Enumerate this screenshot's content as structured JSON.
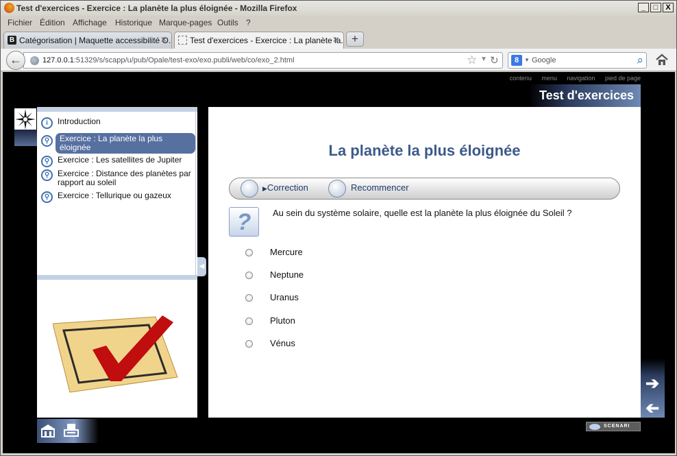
{
  "window": {
    "title": "Test d'exercices - Exercice : La planète la plus éloignée - Mozilla Firefox",
    "controls": {
      "minimize": "_",
      "maximize": "□",
      "close": "X"
    }
  },
  "menu": {
    "items": [
      "Fichier",
      "Édition",
      "Affichage",
      "Historique",
      "Marque-pages",
      "Outils",
      "?"
    ]
  },
  "tabs": [
    {
      "label": "Catégorisation | Maquette accessibilité O...",
      "favicon": "B",
      "active": false
    },
    {
      "label": "Test d'exercices - Exercice : La planète la...",
      "active": true
    }
  ],
  "new_tab_label": "+",
  "navbar": {
    "url_host": "127.0.0.1",
    "url_rest": ":51329/s/scapp/u/pub/Opale/test-exo/exo.publi/web/co/exo_2.html",
    "search_engine_icon": "8",
    "search_placeholder": "Google"
  },
  "access_links": [
    "contenu",
    "menu",
    "navigation",
    "pied de page"
  ],
  "module_title": "Test d'exercices",
  "outline": {
    "items": [
      {
        "label": "Introduction",
        "icon": "i"
      },
      {
        "label": "Exercice : La planète la plus éloignée",
        "icon": "exercise-icon",
        "selected": true
      },
      {
        "label": "Exercice : Les satellites de Jupiter",
        "icon": "exercise-icon"
      },
      {
        "label": "Exercice : Distance des planètes par rapport au soleil",
        "icon": "exercise-icon"
      },
      {
        "label": "Exercice : Tellurique ou gazeux",
        "icon": "exercise-icon"
      }
    ]
  },
  "exercise": {
    "title": "La planète la plus éloignée",
    "toolbar": {
      "correction": "Correction",
      "restart": "Recommencer"
    },
    "question_icon": "?",
    "question": "Au sein du système solaire, quelle est la planète la plus éloignée du Soleil ?",
    "choices": [
      "Mercure",
      "Neptune",
      "Uranus",
      "Pluton",
      "Vénus"
    ]
  },
  "footer": {
    "badge": "SCENARI"
  },
  "colors": {
    "accent": "#3c5a8a",
    "selected_item": "#5670a0",
    "page_background": "#000000"
  }
}
